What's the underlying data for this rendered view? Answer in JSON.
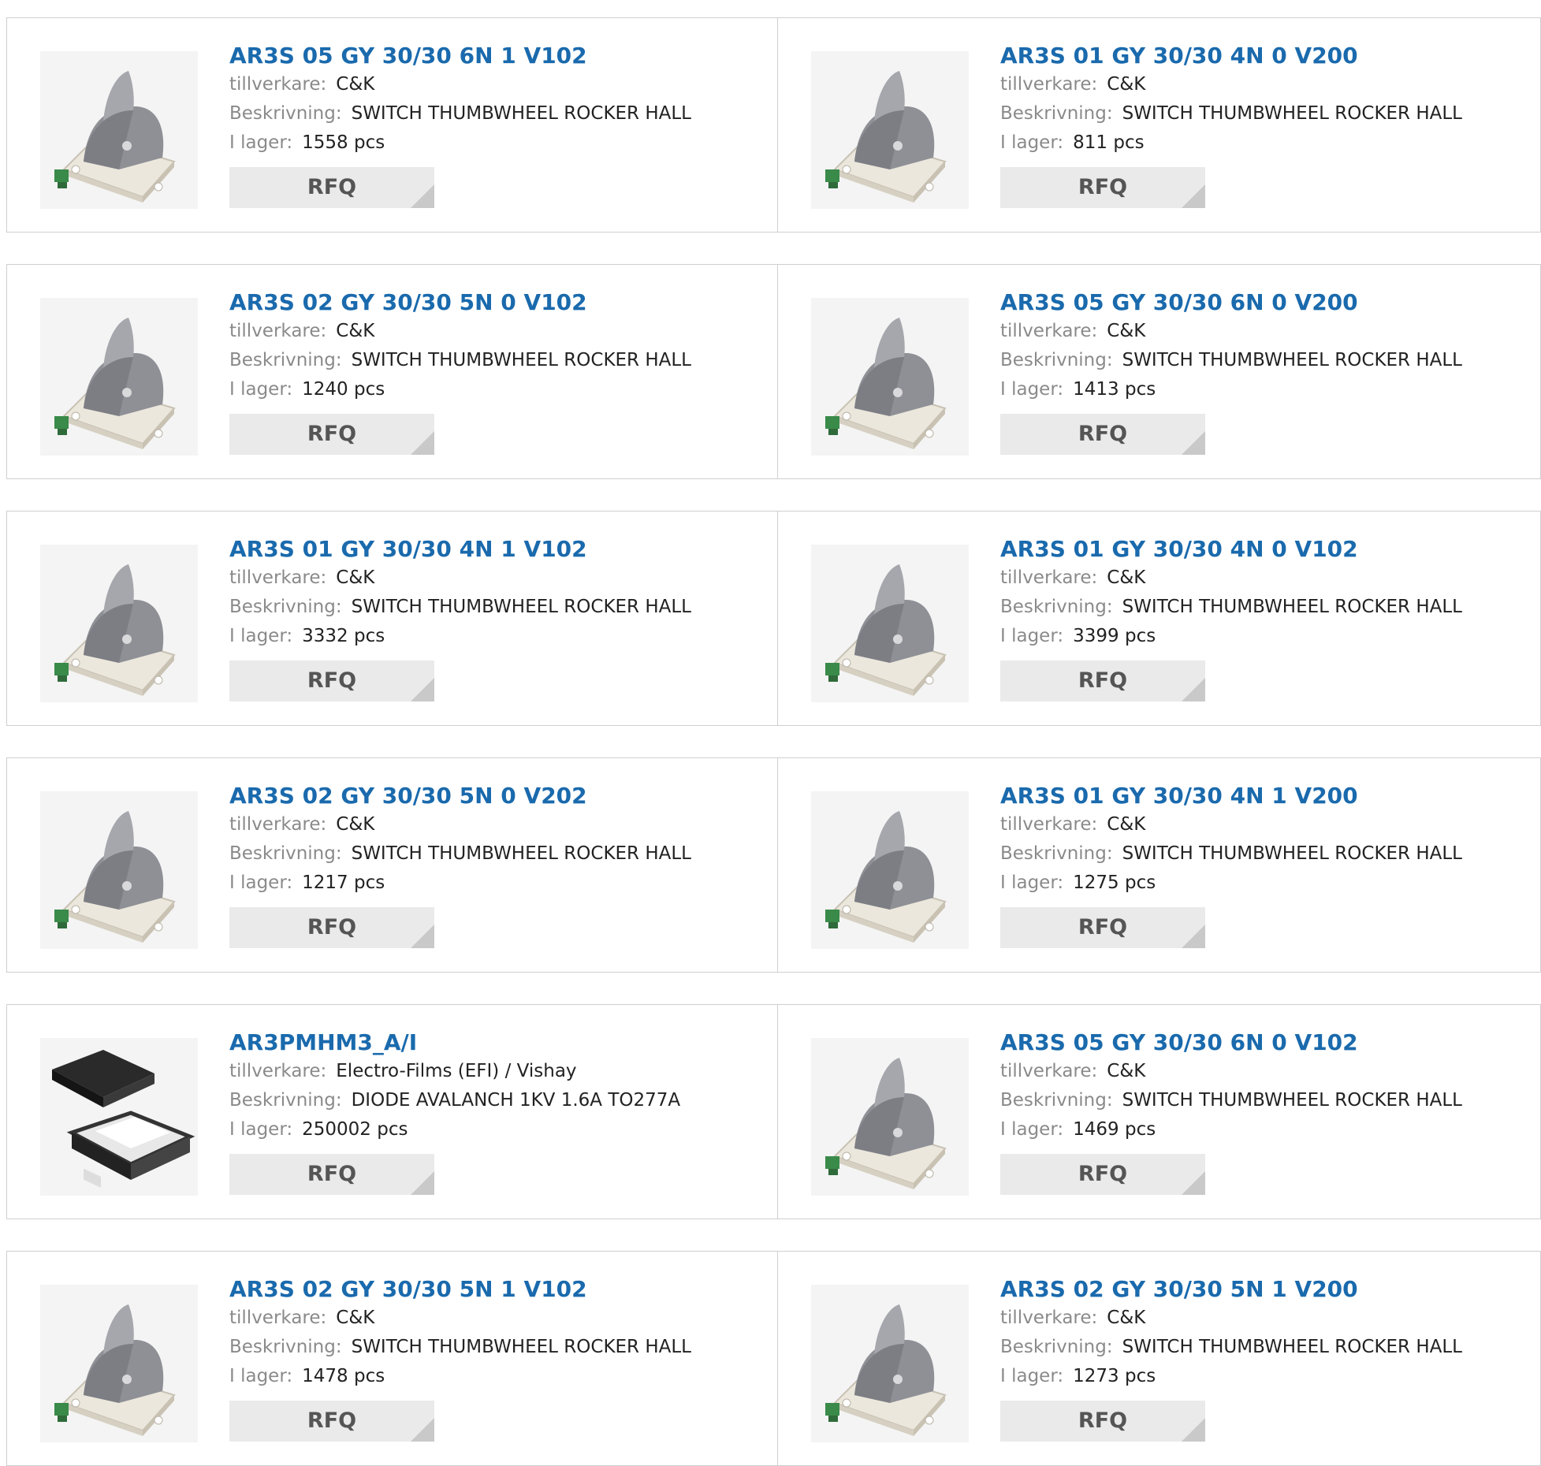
{
  "labels": {
    "manufacturer": "tillverkare:",
    "description": "Beskrivning:",
    "stock": "I lager:",
    "rfq": "RFQ"
  },
  "products": [
    {
      "part": "AR3S 05 GY 30/30 6N 1 V102",
      "manufacturer": "C&K",
      "description": "SWITCH THUMBWHEEL ROCKER HALL",
      "stock": "1558 pcs",
      "image": "rocker-switch-image"
    },
    {
      "part": "AR3S 01 GY 30/30 4N 0 V200",
      "manufacturer": "C&K",
      "description": "SWITCH THUMBWHEEL ROCKER HALL",
      "stock": "811 pcs",
      "image": "rocker-switch-image"
    },
    {
      "part": "AR3S 02 GY 30/30 5N 0 V102",
      "manufacturer": "C&K",
      "description": "SWITCH THUMBWHEEL ROCKER HALL",
      "stock": "1240 pcs",
      "image": "rocker-switch-image"
    },
    {
      "part": "AR3S 05 GY 30/30 6N 0 V200",
      "manufacturer": "C&K",
      "description": "SWITCH THUMBWHEEL ROCKER HALL",
      "stock": "1413 pcs",
      "image": "rocker-switch-image"
    },
    {
      "part": "AR3S 01 GY 30/30 4N 1 V102",
      "manufacturer": "C&K",
      "description": "SWITCH THUMBWHEEL ROCKER HALL",
      "stock": "3332 pcs",
      "image": "rocker-switch-image"
    },
    {
      "part": "AR3S 01 GY 30/30 4N 0 V102",
      "manufacturer": "C&K",
      "description": "SWITCH THUMBWHEEL ROCKER HALL",
      "stock": "3399 pcs",
      "image": "rocker-switch-image"
    },
    {
      "part": "AR3S 02 GY 30/30 5N 0 V202",
      "manufacturer": "C&K",
      "description": "SWITCH THUMBWHEEL ROCKER HALL",
      "stock": "1217 pcs",
      "image": "rocker-switch-image"
    },
    {
      "part": "AR3S 01 GY 30/30 4N 1 V200",
      "manufacturer": "C&K",
      "description": "SWITCH THUMBWHEEL ROCKER HALL",
      "stock": "1275 pcs",
      "image": "rocker-switch-image"
    },
    {
      "part": "AR3PMHM3_A/I",
      "manufacturer": "Electro-Films (EFI) / Vishay",
      "description": "DIODE AVALANCH 1KV 1.6A TO277A",
      "stock": "250002 pcs",
      "image": "diode-package-image"
    },
    {
      "part": "AR3S 05 GY 30/30 6N 0 V102",
      "manufacturer": "C&K",
      "description": "SWITCH THUMBWHEEL ROCKER HALL",
      "stock": "1469 pcs",
      "image": "rocker-switch-image"
    },
    {
      "part": "AR3S 02 GY 30/30 5N 1 V102",
      "manufacturer": "C&K",
      "description": "SWITCH THUMBWHEEL ROCKER HALL",
      "stock": "1478 pcs",
      "image": "rocker-switch-image"
    },
    {
      "part": "AR3S 02 GY 30/30 5N 1 V200",
      "manufacturer": "C&K",
      "description": "SWITCH THUMBWHEEL ROCKER HALL",
      "stock": "1273 pcs",
      "image": "rocker-switch-image"
    }
  ],
  "colors": {
    "title": "#1a6aad",
    "border": "#cfcfcf",
    "rfq_bg": "#eaeaea"
  }
}
